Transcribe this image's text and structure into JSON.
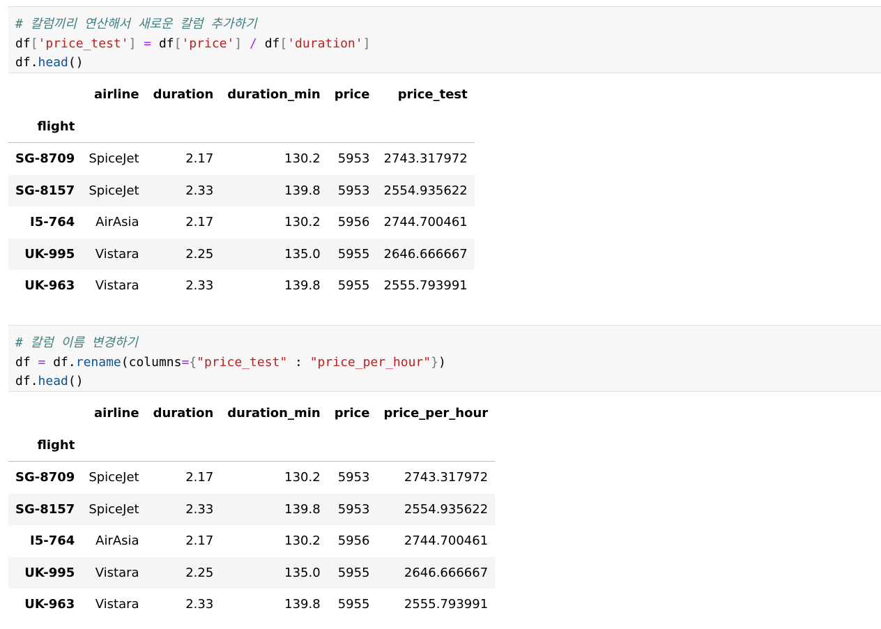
{
  "cell1": {
    "comment": "# 칼럼끼리 연산해서 새로운 칼럼 추가하기",
    "line2": {
      "t1": "df",
      "t2": "[",
      "t3": "'price_test'",
      "t4": "]",
      "t5": " = ",
      "t6": "df",
      "t7": "[",
      "t8": "'price'",
      "t9": "]",
      "t10": " / ",
      "t11": "df",
      "t12": "[",
      "t13": "'duration'",
      "t14": "]"
    },
    "line3": {
      "t1": "df",
      "t2": ".",
      "t3": "head",
      "t4": "()"
    }
  },
  "table1": {
    "columns": [
      "airline",
      "duration",
      "duration_min",
      "price",
      "price_test"
    ],
    "index_name": "flight",
    "rows": [
      {
        "index": "SG-8709",
        "cells": [
          "SpiceJet",
          "2.17",
          "130.2",
          "5953",
          "2743.317972"
        ]
      },
      {
        "index": "SG-8157",
        "cells": [
          "SpiceJet",
          "2.33",
          "139.8",
          "5953",
          "2554.935622"
        ]
      },
      {
        "index": "I5-764",
        "cells": [
          "AirAsia",
          "2.17",
          "130.2",
          "5956",
          "2744.700461"
        ]
      },
      {
        "index": "UK-995",
        "cells": [
          "Vistara",
          "2.25",
          "135.0",
          "5955",
          "2646.666667"
        ]
      },
      {
        "index": "UK-963",
        "cells": [
          "Vistara",
          "2.33",
          "139.8",
          "5955",
          "2555.793991"
        ]
      }
    ]
  },
  "cell2": {
    "comment": "# 칼럼 이름 변경하기",
    "line2": {
      "t1": "df",
      "t2": " = ",
      "t3": "df",
      "t4": ".",
      "t5": "rename",
      "t6": "(",
      "t7": "columns",
      "t8": "=",
      "t9": "{",
      "t10": "\"price_test\"",
      "t11": " : ",
      "t12": "\"price_per_hour\"",
      "t13": "}",
      "t14": ")"
    },
    "line3": {
      "t1": "df",
      "t2": ".",
      "t3": "head",
      "t4": "()"
    }
  },
  "table2": {
    "columns": [
      "airline",
      "duration",
      "duration_min",
      "price",
      "price_per_hour"
    ],
    "index_name": "flight",
    "rows": [
      {
        "index": "SG-8709",
        "cells": [
          "SpiceJet",
          "2.17",
          "130.2",
          "5953",
          "2743.317972"
        ]
      },
      {
        "index": "SG-8157",
        "cells": [
          "SpiceJet",
          "2.33",
          "139.8",
          "5953",
          "2554.935622"
        ]
      },
      {
        "index": "I5-764",
        "cells": [
          "AirAsia",
          "2.17",
          "130.2",
          "5956",
          "2744.700461"
        ]
      },
      {
        "index": "UK-995",
        "cells": [
          "Vistara",
          "2.25",
          "135.0",
          "5955",
          "2646.666667"
        ]
      },
      {
        "index": "UK-963",
        "cells": [
          "Vistara",
          "2.33",
          "139.8",
          "5955",
          "2555.793991"
        ]
      }
    ]
  }
}
